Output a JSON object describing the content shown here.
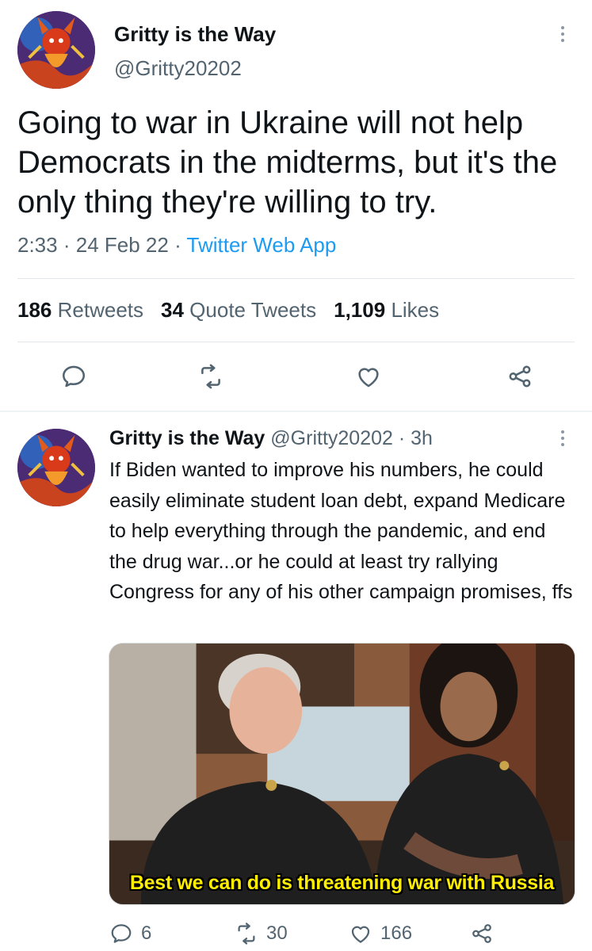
{
  "main_tweet": {
    "author_name": "Gritty is the Way",
    "handle": "@Gritty20202",
    "text": "Going to war in Ukraine will not help Democrats in the midterms, but it's the only thing they're willing to try.",
    "time": "2:33",
    "date": "24 Feb 22",
    "separator": "·",
    "source": "Twitter Web App",
    "stats": {
      "retweets_count": "186",
      "retweets_label": "Retweets",
      "quotes_count": "34",
      "quotes_label": "Quote Tweets",
      "likes_count": "1,109",
      "likes_label": "Likes"
    },
    "actions": [
      "reply-icon",
      "retweet-icon",
      "like-icon",
      "share-icon"
    ]
  },
  "reply_tweet": {
    "author_name": "Gritty is the Way",
    "handle": "@Gritty20202",
    "separator": "·",
    "time_ago": "3h",
    "text": "If Biden wanted to improve his numbers, he could easily eliminate student loan debt, expand Medicare to help everything through the pandemic, and end the drug war...or he could at least try rallying Congress for any of his other campaign promises, ffs",
    "media_caption": "Best we can do is threatening war with Russia",
    "reply_count": "6",
    "retweet_count": "30",
    "like_count": "166"
  },
  "colors": {
    "text": "#0f1419",
    "secondary": "#536471",
    "link": "#1d9bf0",
    "divider": "#e3e7ea",
    "caption": "#ffee00"
  }
}
